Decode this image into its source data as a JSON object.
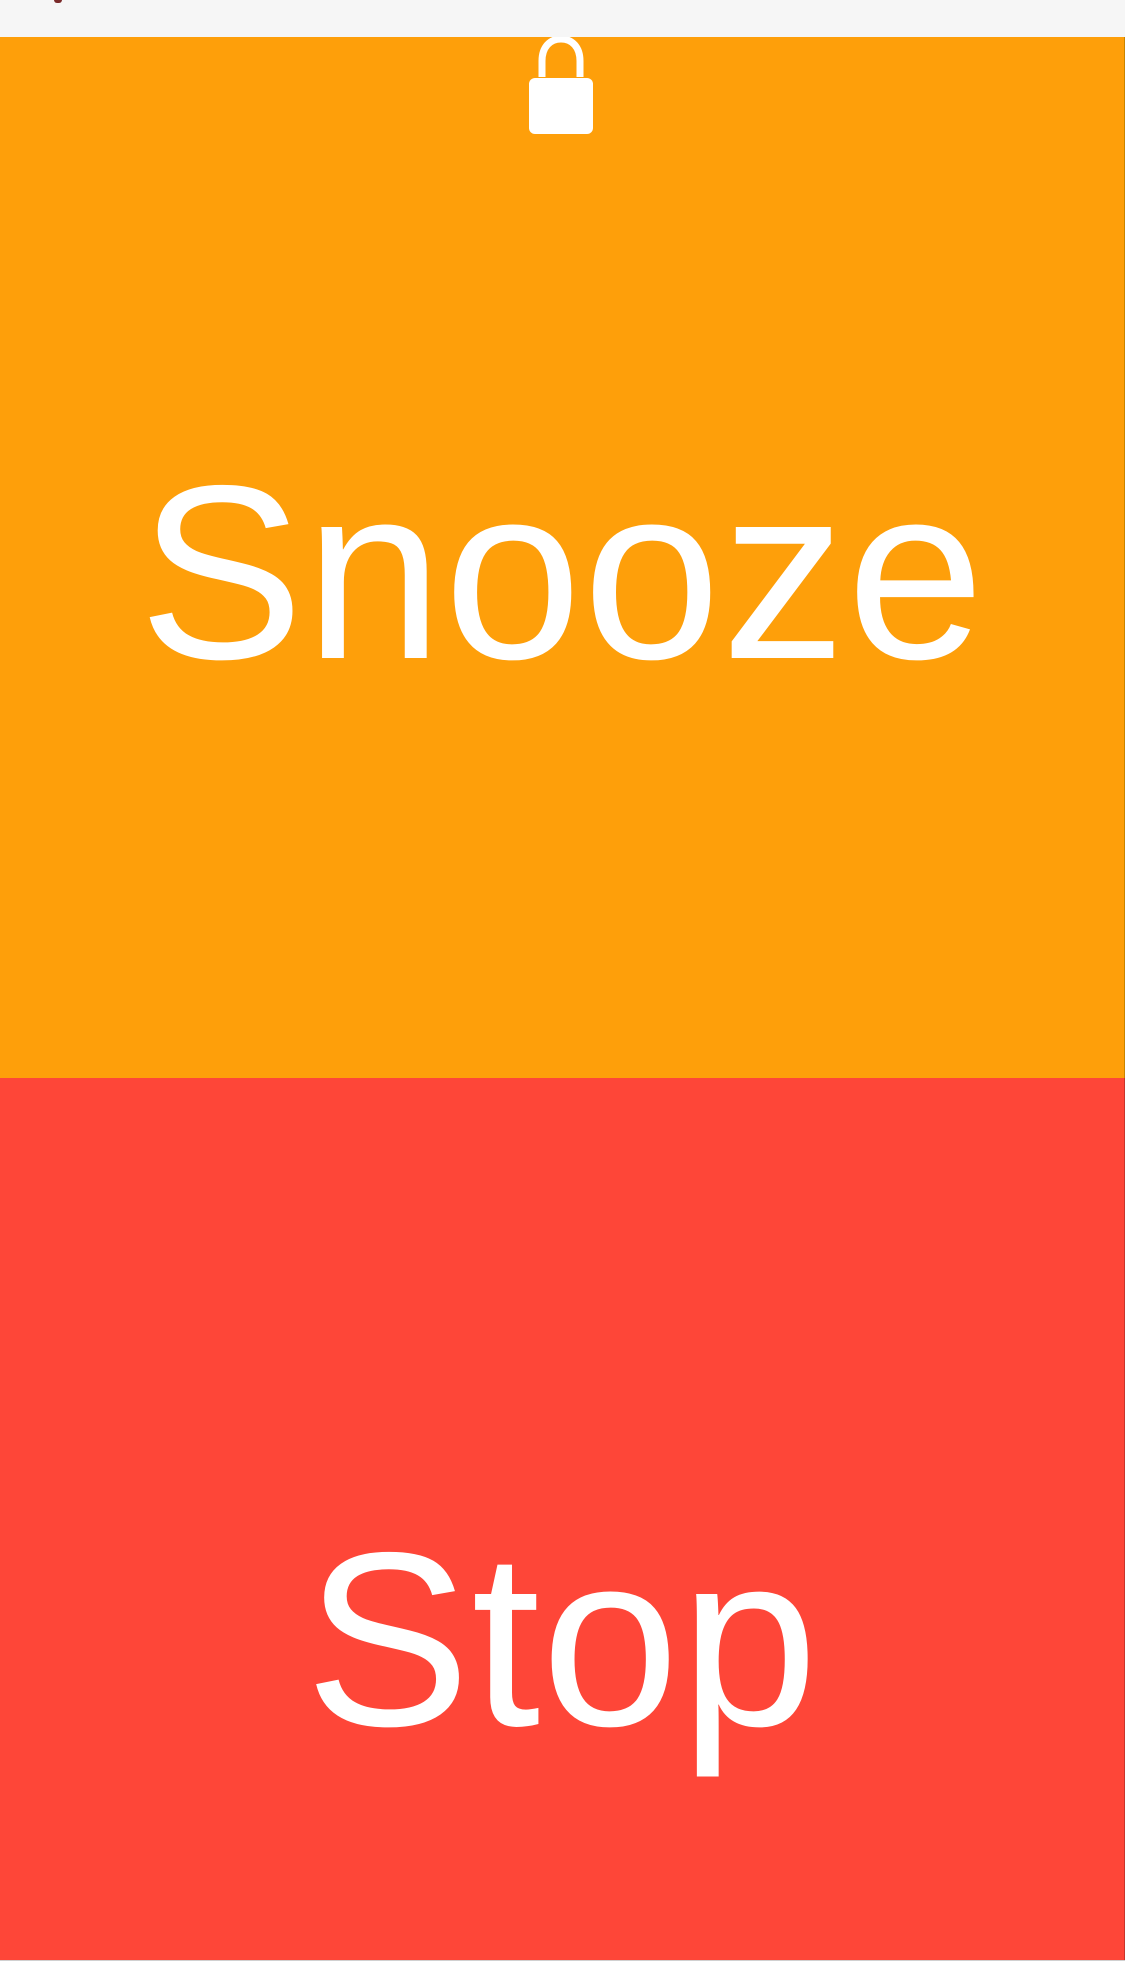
{
  "colors": {
    "snooze_background": "#fe9f0a",
    "stop_background": "#fe4638",
    "label_color": "#ffffff",
    "top_strip": "#f6f6f6"
  },
  "icons": {
    "lock": "lock-icon"
  },
  "buttons": {
    "snooze_label": "Snooze",
    "stop_label": "Stop"
  }
}
